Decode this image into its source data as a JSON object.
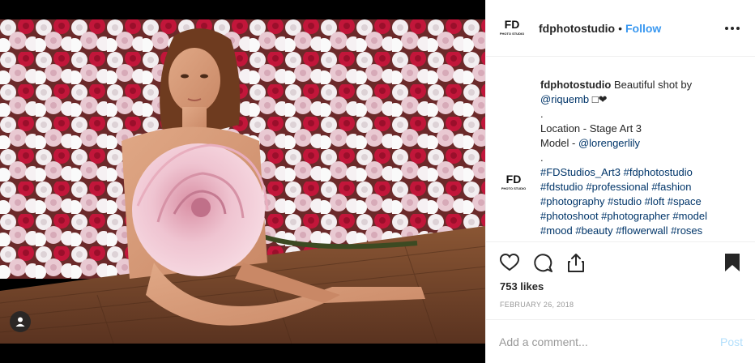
{
  "header": {
    "username": "fdphotostudio",
    "separator": "•",
    "follow_label": "Follow",
    "logo_text_top": "FD",
    "logo_text_bottom": "PHOTO STUDIO"
  },
  "caption": {
    "username": "fdphotostudio",
    "text_line1": " Beautiful shot by",
    "mention_photographer": "@riquemb",
    "emoji": " □❤",
    "dot1": ".",
    "location": "Location - Stage Art 3",
    "model_prefix": "Model - ",
    "mention_model": "@lorengerlily",
    "dot2": ".",
    "hashtag_lines": [
      "#FDStudios_Art3 #fdphotostudio",
      "#fdstudio #professional #fashion",
      "#photography #studio #loft #space",
      "#photoshoot #photographer #model",
      "#mood #beauty #flowerwall #roses"
    ]
  },
  "actions": {
    "icons": [
      "heart-icon",
      "comment-icon",
      "share-icon",
      "bookmark-icon"
    ]
  },
  "likes": "753 likes",
  "date": "FEBRUARY 26, 2018",
  "comment": {
    "placeholder": "Add a comment...",
    "post_label": "Post"
  },
  "colors": {
    "link": "#003569",
    "follow": "#3897f0",
    "post_disabled": "#b2dffc",
    "border": "#efefef"
  }
}
